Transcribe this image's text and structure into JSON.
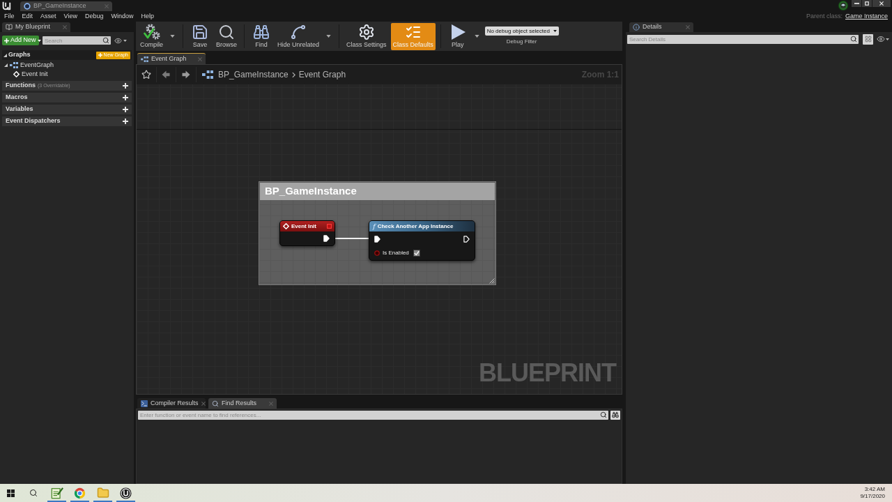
{
  "title_bar": {
    "document_tab": {
      "title": "BP_GameInstance"
    }
  },
  "menu_bar": {
    "items": [
      "File",
      "Edit",
      "Asset",
      "View",
      "Debug",
      "Window",
      "Help"
    ],
    "parent_class": {
      "label": "Parent class:",
      "value": "Game Instance"
    }
  },
  "my_blueprint": {
    "tab": "My Blueprint",
    "add_new": "Add New",
    "search": {
      "placeholder": "Search"
    },
    "graphs": {
      "label": "Graphs",
      "expanded": true,
      "new_graph": "New Graph",
      "items": [
        {
          "label": "EventGraph",
          "expanded": true,
          "children": [
            {
              "label": "Event Init"
            }
          ]
        }
      ]
    },
    "sections": [
      {
        "label": "Functions",
        "note": "(3 Overridable)"
      },
      {
        "label": "Macros"
      },
      {
        "label": "Variables"
      },
      {
        "label": "Event Dispatchers"
      }
    ]
  },
  "toolbar": {
    "groups": [
      {
        "buttons": [
          {
            "kind": "compile",
            "label": "Compile",
            "selected": false,
            "has_menu": true
          }
        ]
      },
      {
        "buttons": [
          {
            "kind": "save",
            "label": "Save",
            "selected": false,
            "has_menu": false
          },
          {
            "kind": "browse",
            "label": "Browse",
            "selected": false,
            "has_menu": false
          }
        ]
      },
      {
        "buttons": [
          {
            "kind": "find",
            "label": "Find",
            "selected": false,
            "has_menu": false
          },
          {
            "kind": "hide_unrelated",
            "label": "Hide Unrelated",
            "selected": false,
            "has_menu": true
          }
        ]
      },
      {
        "buttons": [
          {
            "kind": "class_settings",
            "label": "Class Settings",
            "selected": false,
            "has_menu": false
          },
          {
            "kind": "class_defaults",
            "label": "Class Defaults",
            "selected": true,
            "has_menu": false
          }
        ]
      },
      {
        "buttons": [
          {
            "kind": "play",
            "label": "Play",
            "selected": false,
            "has_menu": true
          }
        ]
      }
    ],
    "debug_filter": {
      "value": "No debug object selected",
      "label": "Debug Filter"
    }
  },
  "graph_tabs": [
    {
      "label": "Event Graph",
      "selected": true
    }
  ],
  "graph": {
    "breadcrumb": [
      "BP_GameInstance",
      "Event Graph"
    ],
    "zoom": "Zoom 1:1",
    "comment": {
      "title": "BP_GameInstance"
    },
    "nodes": [
      {
        "kind": "event",
        "title": "Event Init",
        "exec_out": {
          "connected": true
        }
      },
      {
        "kind": "function",
        "glyph": "f",
        "title": "Check Another App Instance",
        "exec_in": {
          "connected": true
        },
        "exec_out": {
          "connected": false
        },
        "params": [
          {
            "label": "Is Enabled",
            "connected": false,
            "checked": true
          }
        ]
      }
    ],
    "corner_label": "BLUEPRINT"
  },
  "bottom_panel": {
    "tabs": [
      {
        "kind": "compiler",
        "label": "Compiler Results",
        "selected": false
      },
      {
        "kind": "find",
        "label": "Find Results",
        "selected": true
      }
    ],
    "search": {
      "placeholder": "Enter function or event name to find references..."
    }
  },
  "details": {
    "tab": "Details",
    "search": {
      "placeholder": "Search Details"
    }
  },
  "taskbar": {
    "apps": [
      {
        "kind": "notes",
        "running": true
      },
      {
        "kind": "browser",
        "running": true
      },
      {
        "kind": "folder",
        "running": true
      },
      {
        "kind": "engine",
        "running": true
      }
    ],
    "time": "3:42 AM",
    "date": "9/17/2020"
  }
}
